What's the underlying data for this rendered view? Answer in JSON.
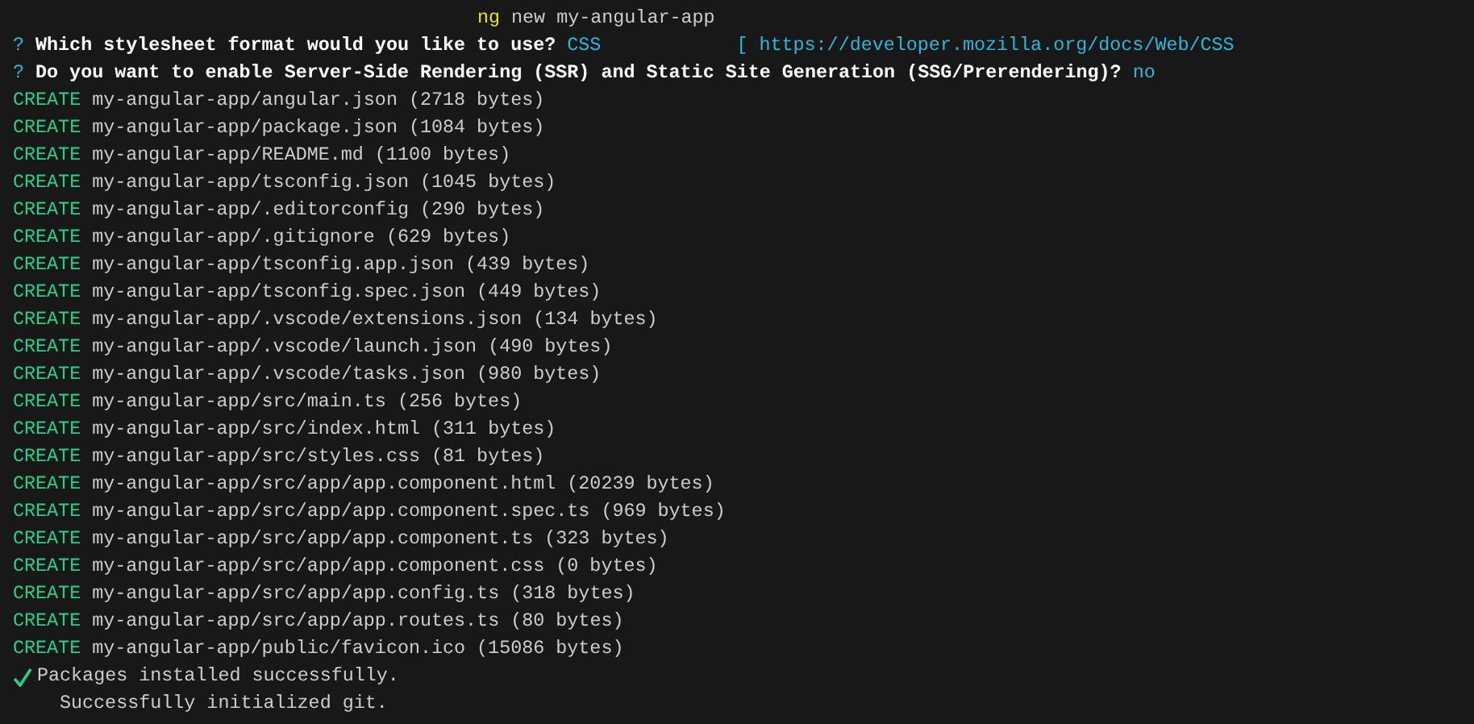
{
  "command": {
    "program": "ng",
    "args": "new my-angular-app"
  },
  "prompts": [
    {
      "mark": "?",
      "question": "Which stylesheet format would you like to use?",
      "answer": "CSS",
      "link": "[ https://developer.mozilla.org/docs/Web/CSS"
    },
    {
      "mark": "?",
      "question": "Do you want to enable Server-Side Rendering (SSR) and Static Site Generation (SSG/Prerendering)?",
      "answer": "no"
    }
  ],
  "created": [
    {
      "action": "CREATE",
      "path": "my-angular-app/angular.json",
      "size": "(2718 bytes)"
    },
    {
      "action": "CREATE",
      "path": "my-angular-app/package.json",
      "size": "(1084 bytes)"
    },
    {
      "action": "CREATE",
      "path": "my-angular-app/README.md",
      "size": "(1100 bytes)"
    },
    {
      "action": "CREATE",
      "path": "my-angular-app/tsconfig.json",
      "size": "(1045 bytes)"
    },
    {
      "action": "CREATE",
      "path": "my-angular-app/.editorconfig",
      "size": "(290 bytes)"
    },
    {
      "action": "CREATE",
      "path": "my-angular-app/.gitignore",
      "size": "(629 bytes)"
    },
    {
      "action": "CREATE",
      "path": "my-angular-app/tsconfig.app.json",
      "size": "(439 bytes)"
    },
    {
      "action": "CREATE",
      "path": "my-angular-app/tsconfig.spec.json",
      "size": "(449 bytes)"
    },
    {
      "action": "CREATE",
      "path": "my-angular-app/.vscode/extensions.json",
      "size": "(134 bytes)"
    },
    {
      "action": "CREATE",
      "path": "my-angular-app/.vscode/launch.json",
      "size": "(490 bytes)"
    },
    {
      "action": "CREATE",
      "path": "my-angular-app/.vscode/tasks.json",
      "size": "(980 bytes)"
    },
    {
      "action": "CREATE",
      "path": "my-angular-app/src/main.ts",
      "size": "(256 bytes)"
    },
    {
      "action": "CREATE",
      "path": "my-angular-app/src/index.html",
      "size": "(311 bytes)"
    },
    {
      "action": "CREATE",
      "path": "my-angular-app/src/styles.css",
      "size": "(81 bytes)"
    },
    {
      "action": "CREATE",
      "path": "my-angular-app/src/app/app.component.html",
      "size": "(20239 bytes)"
    },
    {
      "action": "CREATE",
      "path": "my-angular-app/src/app/app.component.spec.ts",
      "size": "(969 bytes)"
    },
    {
      "action": "CREATE",
      "path": "my-angular-app/src/app/app.component.ts",
      "size": "(323 bytes)"
    },
    {
      "action": "CREATE",
      "path": "my-angular-app/src/app/app.component.css",
      "size": "(0 bytes)"
    },
    {
      "action": "CREATE",
      "path": "my-angular-app/src/app/app.config.ts",
      "size": "(318 bytes)"
    },
    {
      "action": "CREATE",
      "path": "my-angular-app/src/app/app.routes.ts",
      "size": "(80 bytes)"
    },
    {
      "action": "CREATE",
      "path": "my-angular-app/public/favicon.ico",
      "size": "(15086 bytes)"
    }
  ],
  "status": {
    "text": "Packages installed successfully."
  },
  "message": "Successfully initialized git."
}
